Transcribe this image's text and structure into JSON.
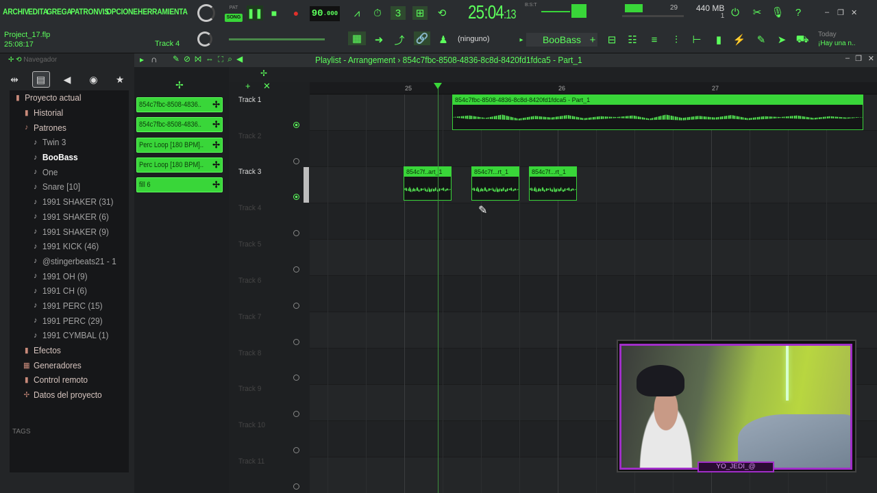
{
  "menu": [
    "ARCHIV",
    "EDITA",
    "GREGA",
    "PATRON",
    "VIS",
    "OPCIONE",
    "HERRAMIENTA"
  ],
  "project": {
    "name": "Project_17.flp",
    "time": "25:08:17"
  },
  "track_hint": "Track 4",
  "patsong": {
    "pat": "PAT",
    "song": "SONG"
  },
  "tempo": {
    "value": "90",
    "decimals": ".000"
  },
  "song_position": {
    "main": "25:04",
    "sub": ":13",
    "label": "B:S:T"
  },
  "memory": {
    "value": "440 MB",
    "cpu": "29",
    "voices": "1"
  },
  "snap": "(ninguno)",
  "current_pattern": "BooBass",
  "news": {
    "label": "Today",
    "text": "¡Hay una n.."
  },
  "browser": {
    "header": "Navegador",
    "items": [
      {
        "label": "Proyecto actual",
        "level": 1,
        "icon": "folder-icon"
      },
      {
        "label": "Historial",
        "level": 2,
        "icon": "folder-icon"
      },
      {
        "label": "Patrones",
        "level": 2,
        "icon": "note-icon"
      },
      {
        "label": "Twin 3",
        "level": 3,
        "icon": "note-icon"
      },
      {
        "label": "BooBass",
        "level": 3,
        "icon": "note-icon",
        "selected": true
      },
      {
        "label": "One",
        "level": 3,
        "icon": "note-icon"
      },
      {
        "label": "Snare [10]",
        "level": 3,
        "icon": "note-icon"
      },
      {
        "label": "1991 SHAKER (31)",
        "level": 3,
        "icon": "note-icon"
      },
      {
        "label": "1991 SHAKER (6)",
        "level": 3,
        "icon": "note-icon"
      },
      {
        "label": "1991 SHAKER (9)",
        "level": 3,
        "icon": "note-icon"
      },
      {
        "label": "1991 KICK (46)",
        "level": 3,
        "icon": "note-icon"
      },
      {
        "label": "@stingerbeats21 - 1",
        "level": 3,
        "icon": "note-icon"
      },
      {
        "label": "1991 OH (9)",
        "level": 3,
        "icon": "note-icon"
      },
      {
        "label": "1991 CH (6)",
        "level": 3,
        "icon": "note-icon"
      },
      {
        "label": "1991 PERC (15)",
        "level": 3,
        "icon": "note-icon"
      },
      {
        "label": "1991 PERC (29)",
        "level": 3,
        "icon": "note-icon"
      },
      {
        "label": "1991 CYMBAL (1)",
        "level": 3,
        "icon": "note-icon"
      },
      {
        "label": "Efectos",
        "level": 2,
        "icon": "folder-icon"
      },
      {
        "label": "Generadores",
        "level": 2,
        "icon": "grid-icon"
      },
      {
        "label": "Control remoto",
        "level": 2,
        "icon": "folder-icon"
      },
      {
        "label": "Datos del proyecto",
        "level": 2,
        "icon": "plus-icon"
      }
    ],
    "tags": "TAGS"
  },
  "picker": [
    "854c7fbc-8508-4836..",
    "854c7fbc-8508-4836..",
    "Perc Loop [180 BPM]..",
    "Perc Loop [180 BPM]..",
    "fill 6"
  ],
  "playlist": {
    "title": "Playlist - Arrangement",
    "sep": "›",
    "pattern": "854c7fbc-8508-4836-8c8d-8420fd1fdca5 - Part_1",
    "ticks": [
      "25",
      "26",
      "27"
    ],
    "tracks": [
      "Track 1",
      "Track 2",
      "Track 3",
      "Track 4",
      "Track 5",
      "Track 6",
      "Track 7",
      "Track 8",
      "Track 9",
      "Track 10",
      "Track 11"
    ],
    "clips": {
      "long": "854c7fbc-8508-4836-8c8d-8420fd1fdca5 - Part_1",
      "short1": "854c7f..art_1",
      "short2": "854c7f...rt_1",
      "short3": "854c7f...rt_1"
    }
  },
  "webcam_tag": "YO_JEDI_@",
  "colors": {
    "accent": "#39d639",
    "text_green": "#5cff5c",
    "cam_border": "#a12ec9"
  }
}
